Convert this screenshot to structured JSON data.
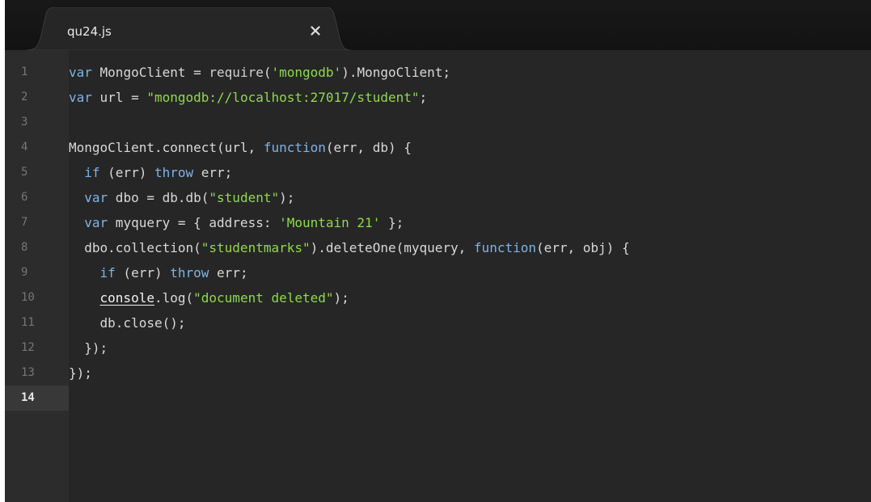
{
  "tab": {
    "filename": "qu24.js",
    "close_icon": "close-icon"
  },
  "editor": {
    "current_line": 14,
    "lines": [
      {
        "n": "1",
        "tokens": [
          [
            "kw",
            "var"
          ],
          [
            "id",
            " MongoClient = "
          ],
          [
            "fn",
            "require"
          ],
          [
            "id",
            "("
          ],
          [
            "str",
            "'mongodb'"
          ],
          [
            "id",
            ").MongoClient;"
          ]
        ]
      },
      {
        "n": "2",
        "tokens": [
          [
            "kw",
            "var"
          ],
          [
            "id",
            " url = "
          ],
          [
            "str",
            "\"mongodb://localhost:27017/student\""
          ],
          [
            "id",
            ";"
          ]
        ]
      },
      {
        "n": "3",
        "tokens": []
      },
      {
        "n": "4",
        "tokens": [
          [
            "id",
            "MongoClient.connect(url, "
          ],
          [
            "kw",
            "function"
          ],
          [
            "id",
            "(err, db) {"
          ]
        ]
      },
      {
        "n": "5",
        "tokens": [
          [
            "id",
            "  "
          ],
          [
            "kw",
            "if"
          ],
          [
            "id",
            " (err) "
          ],
          [
            "kw",
            "throw"
          ],
          [
            "id",
            " err;"
          ]
        ]
      },
      {
        "n": "6",
        "tokens": [
          [
            "id",
            "  "
          ],
          [
            "kw",
            "var"
          ],
          [
            "id",
            " dbo = db.db("
          ],
          [
            "str",
            "\"student\""
          ],
          [
            "id",
            ");"
          ]
        ]
      },
      {
        "n": "7",
        "tokens": [
          [
            "id",
            "  "
          ],
          [
            "kw",
            "var"
          ],
          [
            "id",
            " myquery = { address: "
          ],
          [
            "str",
            "'Mountain 21'"
          ],
          [
            "id",
            " };"
          ]
        ]
      },
      {
        "n": "8",
        "tokens": [
          [
            "id",
            "  dbo.collection("
          ],
          [
            "str",
            "\"studentmarks\""
          ],
          [
            "id",
            ").deleteOne(myquery, "
          ],
          [
            "kw",
            "function"
          ],
          [
            "id",
            "(err, obj) {"
          ]
        ]
      },
      {
        "n": "9",
        "tokens": [
          [
            "id",
            "    "
          ],
          [
            "kw",
            "if"
          ],
          [
            "id",
            " (err) "
          ],
          [
            "kw",
            "throw"
          ],
          [
            "id",
            " err;"
          ]
        ]
      },
      {
        "n": "10",
        "tokens": [
          [
            "id",
            "    "
          ],
          [
            "ul",
            "console"
          ],
          [
            "id",
            ".log("
          ],
          [
            "str",
            "\"document deleted\""
          ],
          [
            "id",
            ");"
          ]
        ]
      },
      {
        "n": "11",
        "tokens": [
          [
            "id",
            "    db.close();"
          ]
        ]
      },
      {
        "n": "12",
        "tokens": [
          [
            "id",
            "  });"
          ]
        ]
      },
      {
        "n": "13",
        "tokens": [
          [
            "id",
            "});"
          ]
        ]
      },
      {
        "n": "14",
        "tokens": []
      }
    ]
  },
  "colors": {
    "keyword": "#7cb3e8",
    "string": "#8fd94c",
    "background": "#262626",
    "gutter": "#2c2c2c"
  }
}
